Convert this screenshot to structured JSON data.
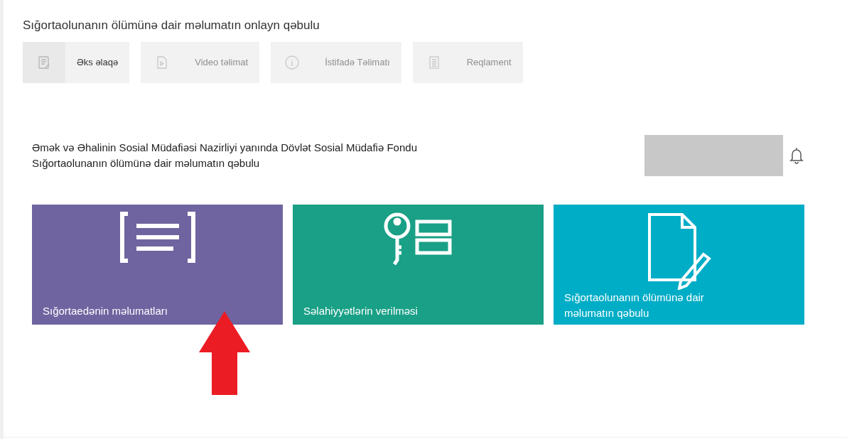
{
  "title": "Sığortaolunanın ölümünə dair məlumatın onlayn qəbulu",
  "toolbar": [
    {
      "kind": "feedback",
      "label": "Əks əlaqə",
      "disabled": false
    },
    {
      "kind": "video",
      "label": "Video təlimat",
      "disabled": true
    },
    {
      "kind": "info",
      "label": "İstifadə Təlimatı",
      "disabled": true
    },
    {
      "kind": "document",
      "label": "Reqlament",
      "disabled": true
    }
  ],
  "header": {
    "lines": [
      "Əmək və Əhalinin Sosial Müdafiəsi Nazirliyi yanında Dövlət Sosial Müdafiə Fondu",
      "Sığortaolunanın ölümünə dair məlumatın qəbulu"
    ]
  },
  "tiles": [
    {
      "kind": "list",
      "label": "Sığortaedənin məlumatları",
      "color": "#6f64a0"
    },
    {
      "kind": "key",
      "label": "Səlahiyyətlərin verilməsi",
      "color": "#19a086"
    },
    {
      "kind": "document",
      "label": "Sığortaolunanın ölümünə dair məlumatın qəbulu",
      "color": "#00adc6"
    }
  ]
}
